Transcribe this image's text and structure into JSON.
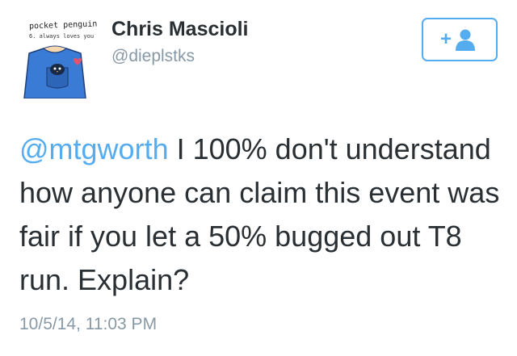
{
  "avatar": {
    "caption_top": "pocket penguin",
    "caption_bottom": "6. always loves you"
  },
  "user": {
    "name": "Chris Mascioli",
    "handle": "@dieplstks"
  },
  "follow_button": {
    "icon": "add-user-icon",
    "label": "+"
  },
  "tweet": {
    "mention": "@mtgworth",
    "body": " I 100% don't understand how anyone can claim this event was fair if you let a 50% bugged out T8 run.  Explain?",
    "timestamp": "10/5/14, 11:03 PM"
  },
  "colors": {
    "accent": "#55acee",
    "muted": "#8899a6",
    "text": "#292f33",
    "avatar_shirt": "#3a7bd5",
    "heart": "#e0556b"
  }
}
